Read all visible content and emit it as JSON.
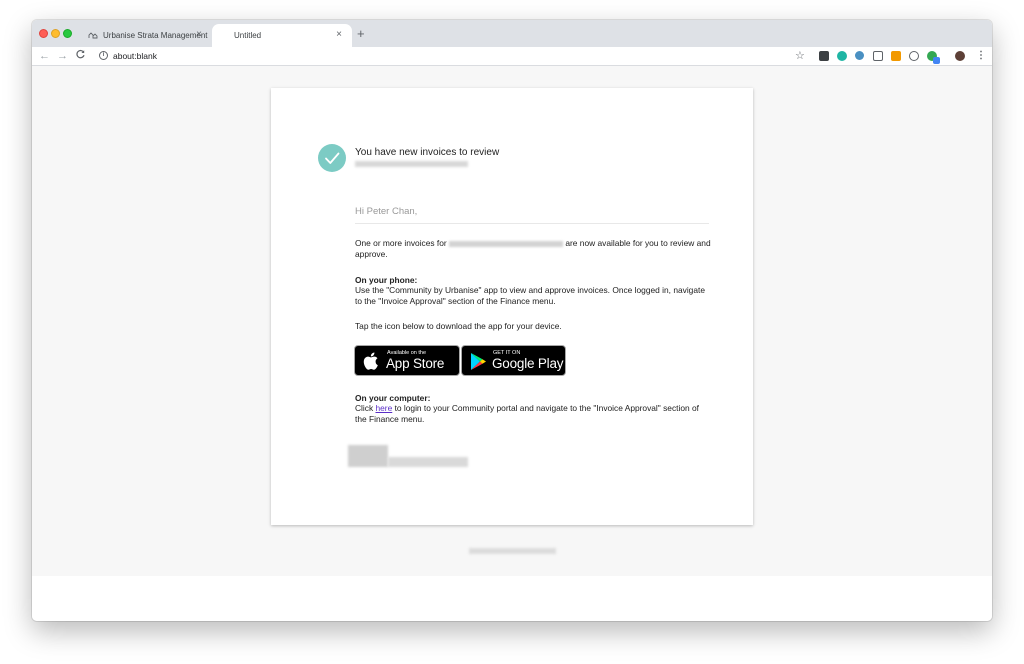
{
  "browser": {
    "tabs": [
      {
        "label": "Urbanise Strata Management",
        "favicon": "urbanise-logo-icon",
        "close": "×"
      },
      {
        "label": "Untitled",
        "close": "×"
      }
    ],
    "new_tab": "+",
    "nav": {
      "back": "←",
      "forward": "→",
      "reload": "C"
    },
    "url": "about:blank",
    "bookmark_star": "☆",
    "menu": "⋮"
  },
  "email": {
    "heading": "You have new invoices to review",
    "greeting": "Hi Peter Chan,",
    "intro_before": "One or more invoices for",
    "intro_after": "are now available for you to review and approve.",
    "phone_heading": "On your phone:",
    "phone_text": "Use the \"Community by Urbanise\" app to view and approve invoices. Once logged in, navigate to the \"Invoice Approval\" section of the Finance menu.",
    "tap_text": "Tap the icon below to download the app for your device.",
    "app_store": {
      "small": "Available on the",
      "big": "App Store"
    },
    "google_play": {
      "small": "GET IT ON",
      "big": "Google Play"
    },
    "computer_heading": "On your computer:",
    "computer_click": "Click",
    "computer_link": "here",
    "computer_text": "to login to your Community portal and navigate to the \"Invoice Approval\" section of the Finance menu."
  },
  "colors": {
    "check_circle": "#7ccbc4",
    "link": "#5a2ec7",
    "page_bg": "#f7f7f7"
  }
}
